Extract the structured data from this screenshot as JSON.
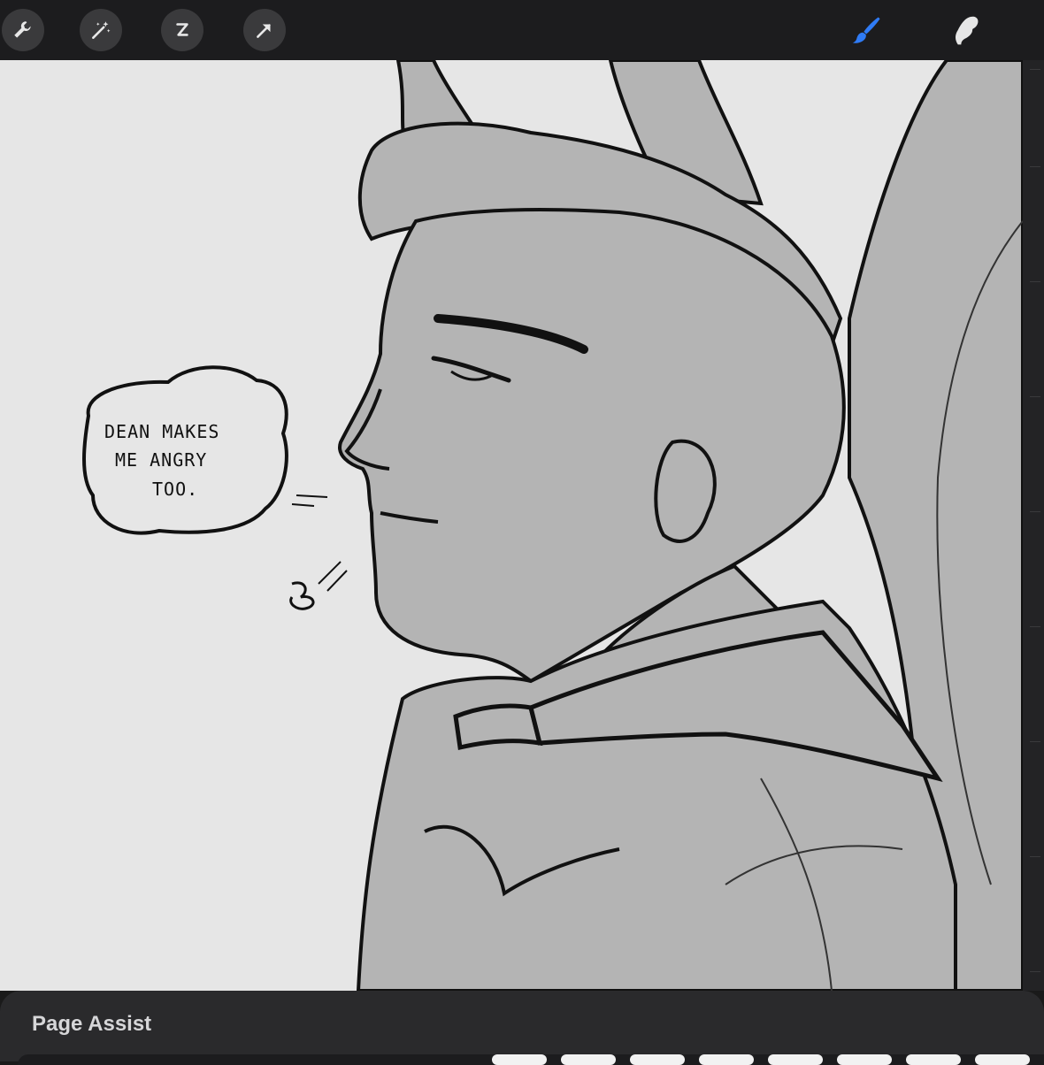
{
  "toolbar": {
    "left_tools": [
      {
        "name": "wrench-icon",
        "label": "Actions"
      },
      {
        "name": "magic-wand-icon",
        "label": "Adjustments"
      },
      {
        "name": "selection-icon",
        "label": "Selection"
      },
      {
        "name": "arrow-cursor-icon",
        "label": "Transform"
      }
    ],
    "right_tools": [
      {
        "name": "brush-icon",
        "active": true
      },
      {
        "name": "smudge-icon",
        "active": false
      }
    ],
    "active_color": "#2f7bf5"
  },
  "canvas": {
    "speech_bubble": {
      "line1": "DEAN MAKES",
      "line2": "ME ANGRY",
      "line3": "TOO."
    },
    "background_color": "#e6e6e6",
    "figure_color": "#b4b4b4"
  },
  "bottom_panel": {
    "title": "Page Assist"
  }
}
